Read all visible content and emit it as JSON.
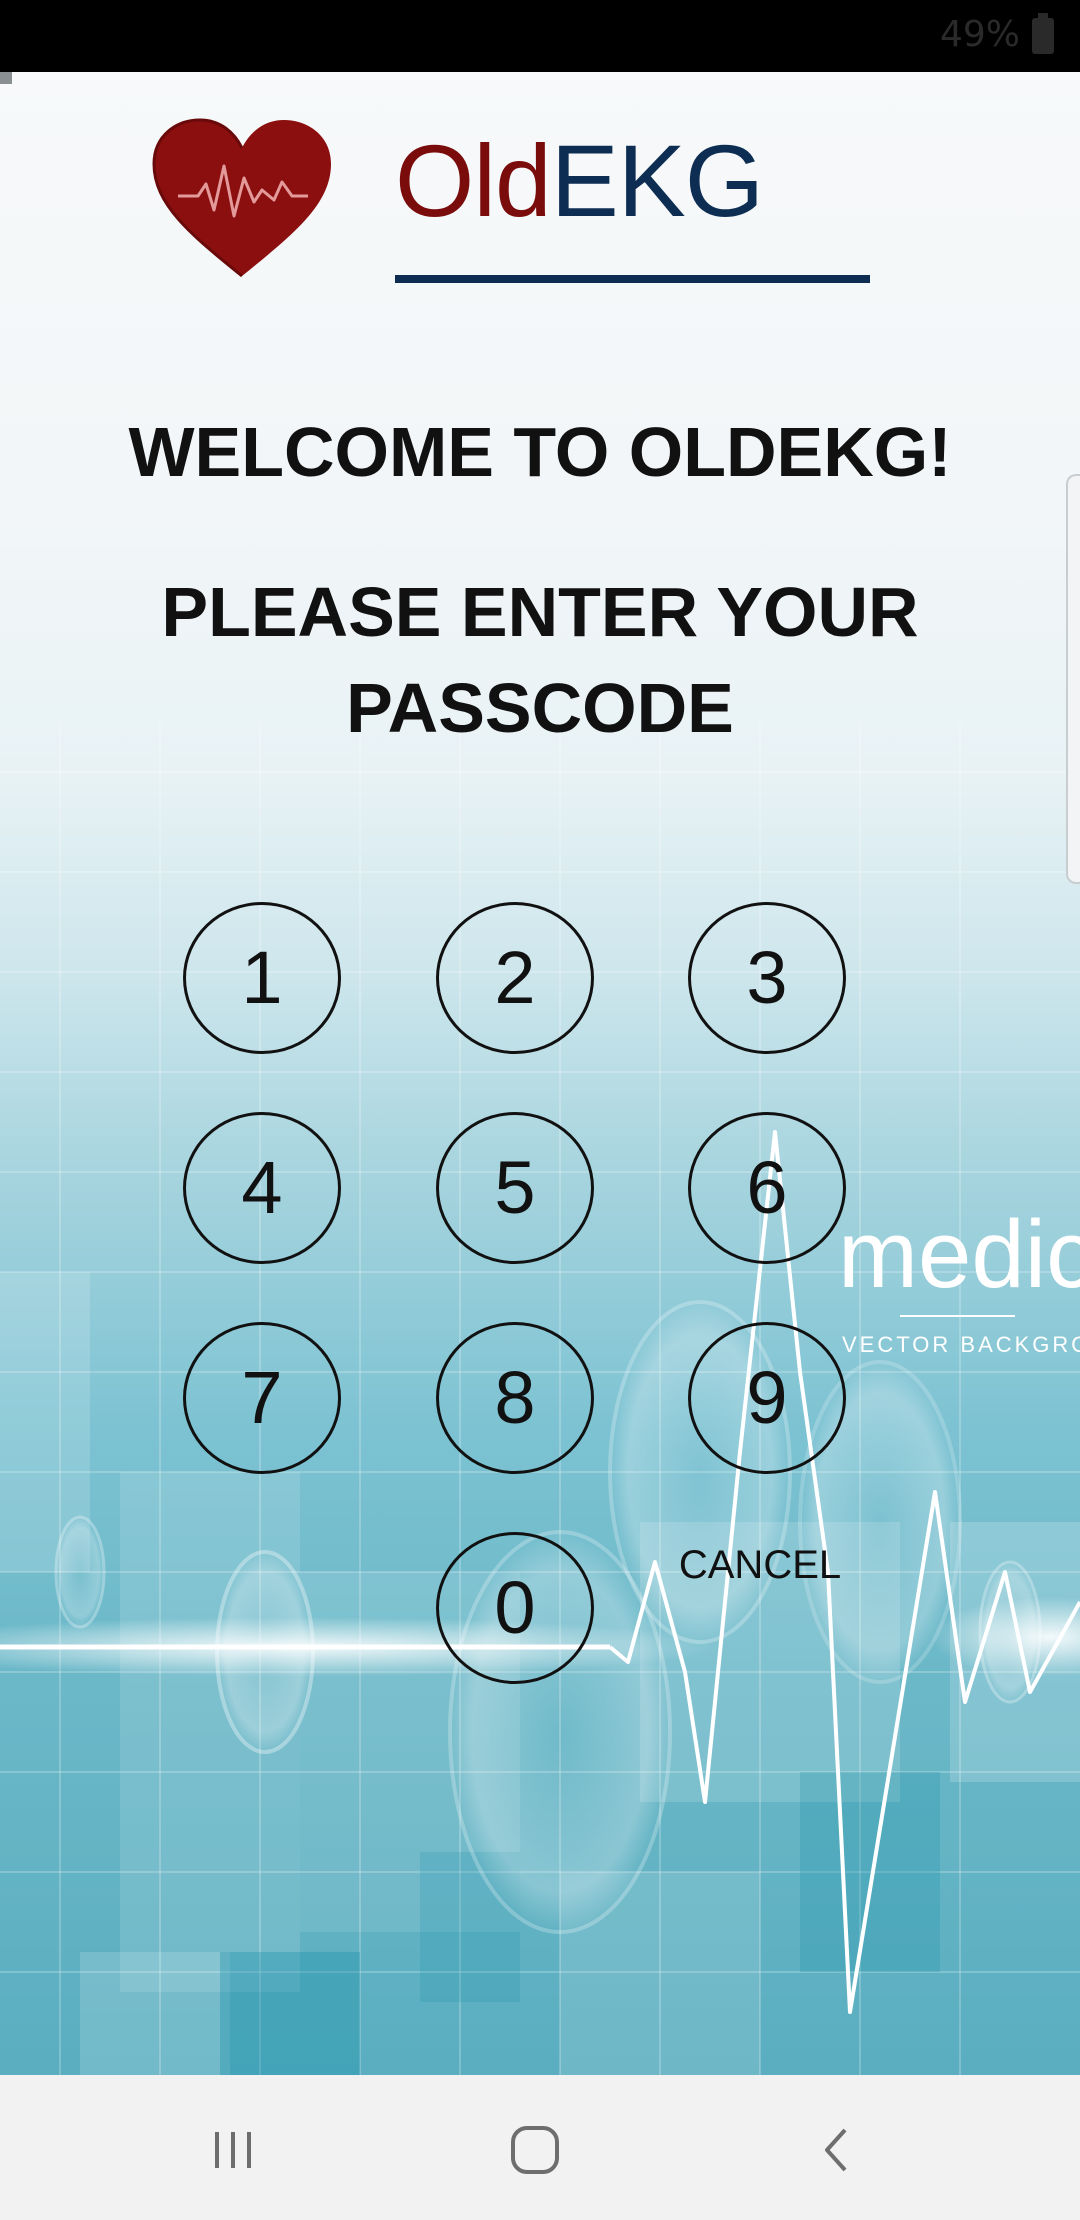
{
  "status_bar": {
    "battery_text": "49%"
  },
  "app": {
    "title_part1": "Old",
    "title_part2": "EKG",
    "welcome": "WELCOME TO OLDEKG!",
    "prompt_line1": "PLEASE ENTER YOUR",
    "prompt_line2": "PASSCODE",
    "background_text": "medical",
    "background_subtext": "VECTOR BACKGROUND",
    "colors": {
      "title_old": "#7a0c0c",
      "title_ekg": "#0d2d52",
      "heart": "#8b0f0f"
    }
  },
  "keypad": {
    "keys": [
      "1",
      "2",
      "3",
      "4",
      "5",
      "6",
      "7",
      "8",
      "9",
      "0"
    ],
    "cancel_label": "CANCEL"
  },
  "nav_bar": {
    "recent_icon": "recent-apps-icon",
    "home_icon": "home-icon",
    "back_icon": "back-icon"
  }
}
